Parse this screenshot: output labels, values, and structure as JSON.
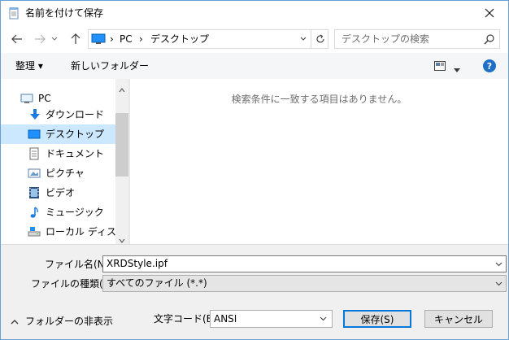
{
  "window": {
    "title": "名前を付けて保存"
  },
  "nav": {
    "address_root": "PC",
    "address_current": "デスクトップ",
    "search_placeholder": "デスクトップの検索"
  },
  "toolbar": {
    "organize_label": "整理 ▾",
    "new_folder_label": "新しいフォルダー",
    "help_label": "?"
  },
  "sidebar": {
    "items": [
      {
        "label": "PC",
        "icon": "pc-icon"
      },
      {
        "label": "ダウンロード",
        "icon": "download-icon"
      },
      {
        "label": "デスクトップ",
        "icon": "desktop-icon",
        "selected": true
      },
      {
        "label": "ドキュメント",
        "icon": "document-icon"
      },
      {
        "label": "ピクチャ",
        "icon": "picture-icon"
      },
      {
        "label": "ビデオ",
        "icon": "video-icon"
      },
      {
        "label": "ミュージック",
        "icon": "music-icon"
      },
      {
        "label": "ローカル ディスク (C",
        "icon": "disk-icon"
      }
    ]
  },
  "content": {
    "empty_message": "検索条件に一致する項目はありません。"
  },
  "form": {
    "filename_label": "ファイル名(N):",
    "filename_value": "XRDStyle.ipf",
    "filetype_label": "ファイルの種類(T):",
    "filetype_value": "すべてのファイル (*.*)",
    "encoding_label": "文字コード(E):",
    "encoding_value": "ANSI",
    "hide_folders_label": "フォルダーの非表示",
    "save_label": "保存(S)",
    "cancel_label": "キャンセル"
  },
  "colors": {
    "accent": "#0078d7",
    "selection": "#cce8ff",
    "folder_blue": "#1e90ff"
  }
}
